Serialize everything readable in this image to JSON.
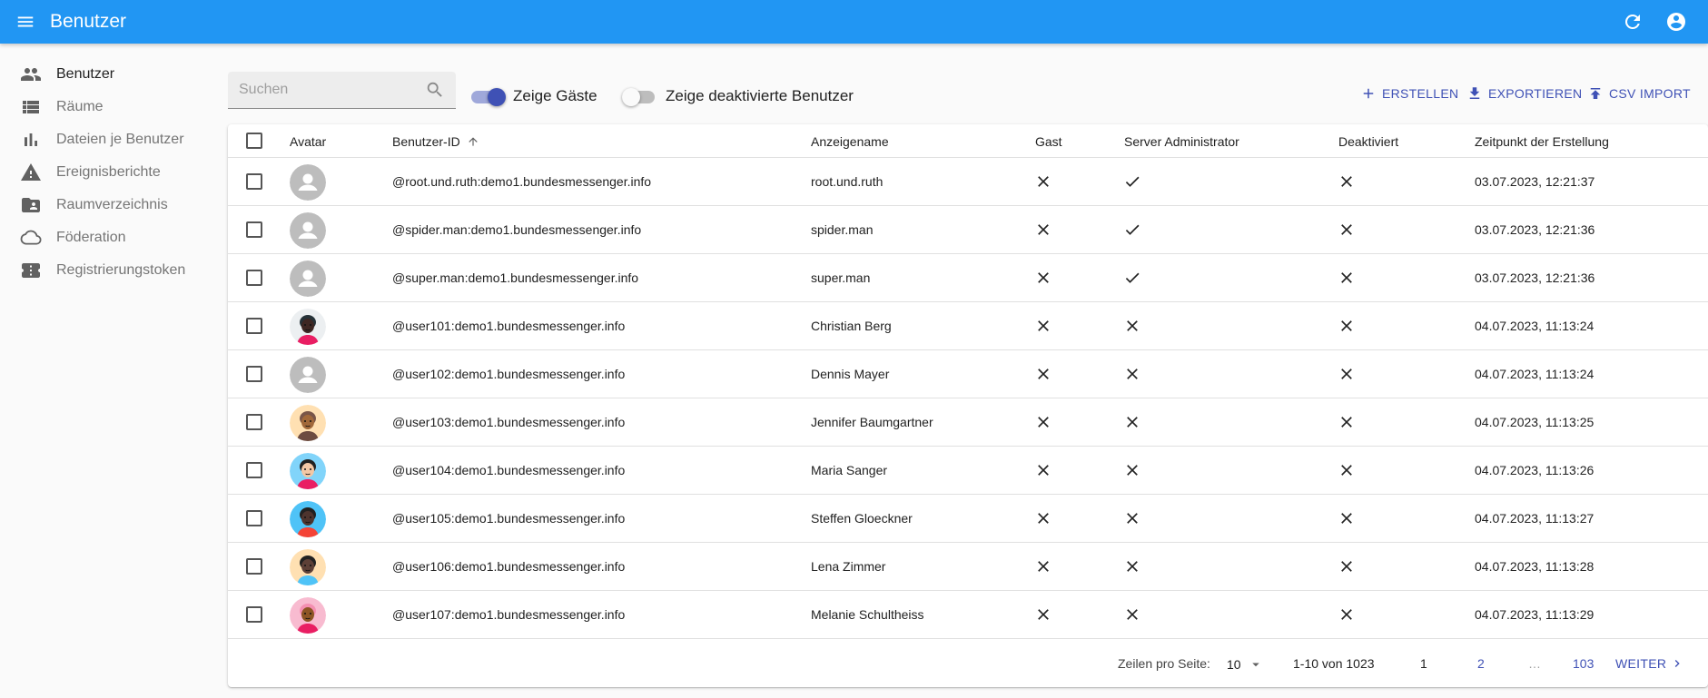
{
  "appbar": {
    "title": "Benutzer"
  },
  "sidebar": {
    "items": [
      {
        "label": "Benutzer",
        "icon": "people-icon",
        "active": true
      },
      {
        "label": "Räume",
        "icon": "list-icon",
        "active": false
      },
      {
        "label": "Dateien je Benutzer",
        "icon": "bar-chart-icon",
        "active": false
      },
      {
        "label": "Ereignisberichte",
        "icon": "warning-icon",
        "active": false
      },
      {
        "label": "Raumverzeichnis",
        "icon": "folder-shared-icon",
        "active": false
      },
      {
        "label": "Föderation",
        "icon": "cloud-icon",
        "active": false
      },
      {
        "label": "Registrierungstoken",
        "icon": "ticket-icon",
        "active": false
      }
    ]
  },
  "toolbar": {
    "search_placeholder": "Suchen",
    "toggle_guests_label": "Zeige Gäste",
    "toggle_guests_on": true,
    "toggle_deactivated_label": "Zeige deaktivierte Benutzer",
    "toggle_deactivated_on": false,
    "create_label": "ERSTELLEN",
    "export_label": "EXPORTIEREN",
    "csv_import_label": "CSV IMPORT"
  },
  "table": {
    "columns": {
      "avatar": "Avatar",
      "user_id": "Benutzer-ID",
      "display_name": "Anzeigename",
      "guest": "Gast",
      "admin": "Server Administrator",
      "deactivated": "Deaktiviert",
      "created": "Zeitpunkt der Erstellung"
    },
    "rows": [
      {
        "id": "@root.und.ruth:demo1.bundesmessenger.info",
        "name": "root.und.ruth",
        "guest": false,
        "admin": true,
        "deactivated": false,
        "created": "03.07.2023, 12:21:37",
        "avatar": "default"
      },
      {
        "id": "@spider.man:demo1.bundesmessenger.info",
        "name": "spider.man",
        "guest": false,
        "admin": true,
        "deactivated": false,
        "created": "03.07.2023, 12:21:36",
        "avatar": "default"
      },
      {
        "id": "@super.man:demo1.bundesmessenger.info",
        "name": "super.man",
        "guest": false,
        "admin": true,
        "deactivated": false,
        "created": "03.07.2023, 12:21:36",
        "avatar": "default"
      },
      {
        "id": "@user101:demo1.bundesmessenger.info",
        "name": "Christian Berg",
        "guest": false,
        "admin": false,
        "deactivated": false,
        "created": "04.07.2023, 11:13:24",
        "avatar": "photo"
      },
      {
        "id": "@user102:demo1.bundesmessenger.info",
        "name": "Dennis Mayer",
        "guest": false,
        "admin": false,
        "deactivated": false,
        "created": "04.07.2023, 11:13:24",
        "avatar": "default"
      },
      {
        "id": "@user103:demo1.bundesmessenger.info",
        "name": "Jennifer Baumgartner",
        "guest": false,
        "admin": false,
        "deactivated": false,
        "created": "04.07.2023, 11:13:25",
        "avatar": "photo"
      },
      {
        "id": "@user104:demo1.bundesmessenger.info",
        "name": "Maria Sanger",
        "guest": false,
        "admin": false,
        "deactivated": false,
        "created": "04.07.2023, 11:13:26",
        "avatar": "photo"
      },
      {
        "id": "@user105:demo1.bundesmessenger.info",
        "name": "Steffen Gloeckner",
        "guest": false,
        "admin": false,
        "deactivated": false,
        "created": "04.07.2023, 11:13:27",
        "avatar": "photo"
      },
      {
        "id": "@user106:demo1.bundesmessenger.info",
        "name": "Lena Zimmer",
        "guest": false,
        "admin": false,
        "deactivated": false,
        "created": "04.07.2023, 11:13:28",
        "avatar": "photo"
      },
      {
        "id": "@user107:demo1.bundesmessenger.info",
        "name": "Melanie Schultheiss",
        "guest": false,
        "admin": false,
        "deactivated": false,
        "created": "04.07.2023, 11:13:29",
        "avatar": "photo"
      }
    ]
  },
  "pagination": {
    "rows_per_page_label": "Zeilen pro Seite:",
    "rows_per_page": "10",
    "range": "1-10 von 1023",
    "pages": [
      "1",
      "2",
      "…",
      "103"
    ],
    "current_page": "1",
    "next_label": "WEITER"
  },
  "colors": {
    "appbar": "#2196f3",
    "primary": "#3f51b5",
    "toggle_track_on": "#9fa8da",
    "toggle_knob_on": "#3f51b5"
  }
}
